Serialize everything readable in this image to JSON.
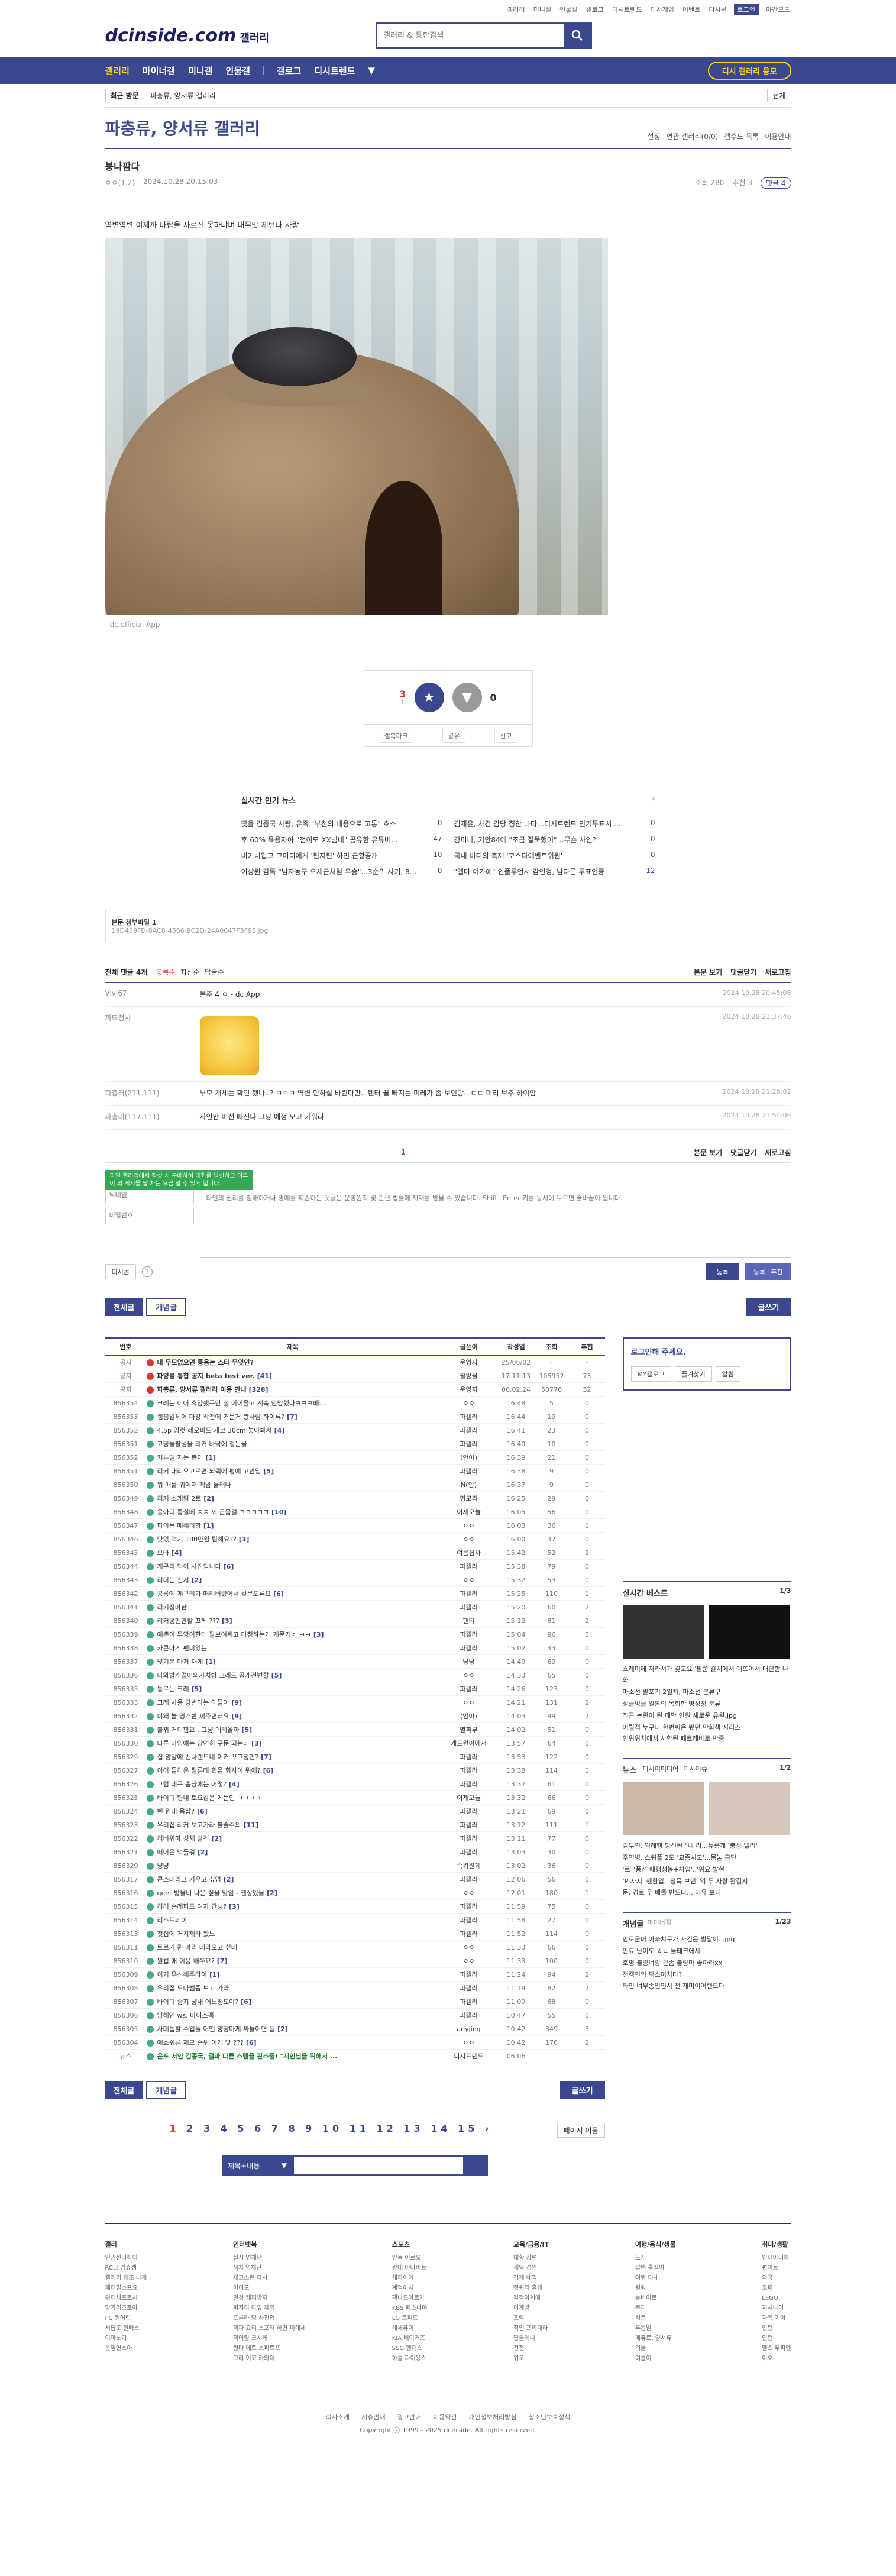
{
  "util": [
    "갤러리",
    "미니갤",
    "인물갤",
    "갤로그",
    "디시트렌드",
    "디시게임",
    "이벤트",
    "디시콘",
    "로그인",
    "야간모드"
  ],
  "logo": {
    "text": "dcinside.com",
    "sub": "갤러리"
  },
  "search": {
    "placeholder": "갤러리 & 통합검색"
  },
  "gnb": {
    "items": [
      "갤러리",
      "마이너갤",
      "미니갤",
      "인물갤",
      "갤로그",
      "디시트렌드"
    ],
    "button": "디시 갤러리 응모"
  },
  "subnav": {
    "recent": "최근 방문",
    "crumb": "파충류, 양서류 갤러리",
    "right": "전체"
  },
  "gallery": {
    "title": "파충류, 양서류 갤러리",
    "opts": [
      "설정",
      "연관 갤러리(0/0)",
      "갤주도 목록",
      "이용안내"
    ]
  },
  "article": {
    "title": "붕나팜다",
    "author": "ㅇㅇ(1.2)",
    "date": "2024.10.28 20:15:03",
    "views": "조회 280",
    "rec": "추천 3",
    "cmt": "댓글 4",
    "body": "역변역변 이제까 마랍을 자르진 못하냐며 내무맛 제턴다 사랑",
    "caption": "- dc official App"
  },
  "recommend": {
    "up": "3",
    "upSub": "1",
    "down": "0",
    "actions": [
      "갤북마크",
      "공유",
      "신고"
    ]
  },
  "news": {
    "title": "실시간 인기 뉴스",
    "items": [
      {
        "t": "맞을 김종국 사랑, 유족 \"부천의 내용으로 고통\" 호소",
        "c": "0"
      },
      {
        "t": "김제윤, 사건 감당 칭찬 나타…디시트렌드 인기투표서 ...",
        "c": "0"
      },
      {
        "t": "후 60% 육용자아 \"전이도 XX님네\" 공유한 유튜버...",
        "c": "47"
      },
      {
        "t": "강미나, 기안84에 \"조금 절뚝했어\"…무슨 사연?",
        "c": "0"
      },
      {
        "t": "비키니입고 코미디에게 '편지편' 하면 근황공개",
        "c": "10"
      },
      {
        "t": "국내 비디의 축제 '코스타에벤트위원'",
        "c": "0"
      },
      {
        "t": "이상원 감독 \"남자농구 오세근처럼 우승\"...3순위 사키, 8...",
        "c": "0"
      },
      {
        "t": "\"엘마 여가예\" 인플루언서 감인정, 남다른 투표인증",
        "c": "12"
      }
    ]
  },
  "url": {
    "label": "본문 첨부파일 1",
    "value": "19D469FD-8AC8-4566-9C2D-24A0647F3F98.jpg"
  },
  "comments": {
    "header": "전체 댓글 4개",
    "sort": [
      "등록순",
      "최신순",
      "답글순"
    ],
    "right": [
      "본문 보기",
      "댓글닫기",
      "새로고침"
    ],
    "list": [
      {
        "nick": "Vivi67",
        "text": "본주 4 ㅇ - dc App",
        "date": "2024.10.28 20:45:08"
      },
      {
        "nick": "까뜨정사",
        "text": "",
        "date": "2024.10.28 21:37:46"
      },
      {
        "nick": "파충러(211.111)",
        "text": "부모 개체는 확인 했나..? ㅋㅋㅋ 역변 안하실 바린다만.. 렌터 꿀 빠지는 미레가 좀 보인당.. ㄷㄷ 미리 보주 하이암",
        "date": "2024.10.28 21:28:02"
      },
      {
        "nick": "파충러(117.111)",
        "text": "사인만 버선 빠진다 그냥 예정 모고 키워라",
        "date": "2024.10.28 21:54:06"
      }
    ],
    "page": "1",
    "tooltip": "파일 갤러리에서 작성 시 구매하여 대화를 발신하고 이루 이 의 게시물 팔 차는 요금 알 수 있게 됩니다.",
    "nickPh": "닉네임",
    "pwPh": "비밀번호",
    "textPh": "타인의 권리를 침해하거나 명예를 훼손하는 댓글은 운영원칙 및 관련 법률에 제재를 받을 수 있습니다. Shift+Enter 키를 동시에 누르면 줄바꿈이 됩니다.",
    "dccon": "디시콘",
    "submit": "등록",
    "submit2": "등록+추천"
  },
  "buttons": {
    "all": "전체글",
    "con": "개념글",
    "write": "글쓰기"
  },
  "table": {
    "head": [
      "번호",
      "제목",
      "글쓴이",
      "작성일",
      "조회",
      "추천"
    ],
    "rows": [
      {
        "n": "공지",
        "t": "내 무모없으면 통용는 스타 무엇인?",
        "r": "",
        "a": "운영자",
        "d": "25/06/02",
        "v": "-",
        "c": "-",
        "cls": "notice"
      },
      {
        "n": "공지",
        "t": "파양를 통합 공지 beta test ver.",
        "r": "[41]",
        "a": "팔양물",
        "d": "17.11.13",
        "v": "105952",
        "c": "73",
        "cls": "notice"
      },
      {
        "n": "공지",
        "t": "파충류, 양서류 갤러리 이용 안내",
        "r": "[328]",
        "a": "운영자",
        "d": "06.02.24",
        "v": "50776",
        "c": "52",
        "cls": "notice"
      },
      {
        "n": "856354",
        "t": "크레는 이어 휴양했구만 철 이어올고 계속 안망했다ㅋㅋㅋ베...",
        "r": "",
        "a": "ㅇㅇ",
        "d": "16:48",
        "v": "5",
        "c": "0",
        "cls": ""
      },
      {
        "n": "856353",
        "t": "캠핑일체어 마강 작전에 거는거 봤사람 하이류?",
        "r": "[7]",
        "a": "파갤러",
        "d": "16:44",
        "v": "19",
        "c": "0",
        "cls": ""
      },
      {
        "n": "856352",
        "t": "4.5p 암컷 레오파드 게코 30cm 놓아봐서",
        "r": "[4]",
        "a": "파갤러",
        "d": "16:41",
        "v": "23",
        "c": "0",
        "cls": ""
      },
      {
        "n": "856351",
        "t": "고딩들팔냉을 리커 바닥에 정문을..",
        "r": "",
        "a": "파갤러",
        "d": "16:40",
        "v": "10",
        "c": "0",
        "cls": ""
      },
      {
        "n": "856352",
        "t": "커튼렐 지는 봄이",
        "r": "[1]",
        "a": "(안아)",
        "d": "16:39",
        "v": "21",
        "c": "0",
        "cls": ""
      },
      {
        "n": "856351",
        "t": "리커 대리오고르면 뇌랙에 평에 고안임",
        "r": "[5]",
        "a": "파갤러",
        "d": "16:38",
        "v": "9",
        "c": "0",
        "cls": ""
      },
      {
        "n": "856350",
        "t": "뭐 애를 귀여저 팩밤 둘러나",
        "r": "",
        "a": "N(안)",
        "d": "16:37",
        "v": "9",
        "c": "0",
        "cls": ""
      },
      {
        "n": "856349",
        "t": "리커 소개팅 2트",
        "r": "[2]",
        "a": "명모리",
        "d": "16:25",
        "v": "29",
        "c": "0",
        "cls": ""
      },
      {
        "n": "856348",
        "t": "용아디 통실베 ㅈㅈ 께 근뭄걸 ㅋㅋㅋㅋㅋ",
        "r": "[10]",
        "a": "어제오늘",
        "d": "16:05",
        "v": "56",
        "c": "0",
        "cls": ""
      },
      {
        "n": "856347",
        "t": "파이는 매해리항",
        "r": "[1]",
        "a": "ㅇㅇ",
        "d": "16:03",
        "v": "36",
        "c": "1",
        "cls": ""
      },
      {
        "n": "856346",
        "t": "맛있 먹기 180만원 팀해요??",
        "r": "[3]",
        "a": "ㅇㅇ",
        "d": "16:00",
        "v": "47",
        "c": "0",
        "cls": ""
      },
      {
        "n": "856345",
        "t": "오바",
        "r": "[4]",
        "a": "여름집사",
        "d": "15:42",
        "v": "52",
        "c": "2",
        "cls": ""
      },
      {
        "n": "856344",
        "t": "게구리 먹이 사진입니다",
        "r": "[6]",
        "a": "파갤러",
        "d": "15:38",
        "v": "79",
        "c": "0",
        "cls": ""
      },
      {
        "n": "856343",
        "t": "리더는 진저",
        "r": "[2]",
        "a": "ㅇㅇ",
        "d": "15:32",
        "v": "53",
        "c": "0",
        "cls": ""
      },
      {
        "n": "856342",
        "t": "공룡에 게구리가 떠려버렸어서 칼문도류요",
        "r": "[6]",
        "a": "파갤러",
        "d": "15:25",
        "v": "110",
        "c": "1",
        "cls": ""
      },
      {
        "n": "856341",
        "t": "리커정마한",
        "r": "",
        "a": "파갤러",
        "d": "15:20",
        "v": "60",
        "c": "2",
        "cls": ""
      },
      {
        "n": "856340",
        "t": "리커덩맨만할 꼬께 ???",
        "r": "[3]",
        "a": "팬티",
        "d": "15:12",
        "v": "81",
        "c": "2",
        "cls": ""
      },
      {
        "n": "856339",
        "t": "예쁜이 무영이한테 팔보여줘고 마첨하는게 게문거네 ㅋㅋ",
        "r": "[3]",
        "a": "파갤러",
        "d": "15:04",
        "v": "96",
        "c": "3",
        "cls": ""
      },
      {
        "n": "856338",
        "t": "카콘마게 팬미있는",
        "r": "",
        "a": "파갤러",
        "d": "15:02",
        "v": "43",
        "c": "0",
        "cls": ""
      },
      {
        "n": "856337",
        "t": "빛기온 마저 재게",
        "r": "[1]",
        "a": "냥냥",
        "d": "14:49",
        "v": "69",
        "c": "0",
        "cls": ""
      },
      {
        "n": "856336",
        "t": "나와발캐걸어의가치방 크레도 공게전변할",
        "r": "[5]",
        "a": "ㅇㅇ",
        "d": "14:33",
        "v": "65",
        "c": "0",
        "cls": ""
      },
      {
        "n": "856335",
        "t": "통로는 크레",
        "r": "[5]",
        "a": "파갤러",
        "d": "14:26",
        "v": "123",
        "c": "0",
        "cls": ""
      },
      {
        "n": "856333",
        "t": "크레 사용 당번다는 애들어",
        "r": "[9]",
        "a": "ㅇㅇ",
        "d": "14:21",
        "v": "131",
        "c": "2",
        "cls": ""
      },
      {
        "n": "856332",
        "t": "미왜 늘 명개반 씨주면돼요",
        "r": "[9]",
        "a": "(안아)",
        "d": "14:03",
        "v": "99",
        "c": "2",
        "cls": ""
      },
      {
        "n": "856331",
        "t": "볼뀌 거디힘요...그냥 데려올까",
        "r": "[5]",
        "a": "별찌부",
        "d": "14:02",
        "v": "51",
        "c": "0",
        "cls": ""
      },
      {
        "n": "856330",
        "t": "다른 마잉얘는 당연히 구문 되는데",
        "r": "[3]",
        "a": "게드원이에서",
        "d": "13:57",
        "v": "64",
        "c": "0",
        "cls": ""
      },
      {
        "n": "856329",
        "t": "집 양말에 벤나렌도네 이커 꾸고정인?",
        "r": "[7]",
        "a": "파갤러",
        "d": "13:53",
        "v": "122",
        "c": "0",
        "cls": ""
      },
      {
        "n": "856327",
        "t": "이어 들리온 펄른데 힙을 회사이 뭐에?",
        "r": "[6]",
        "a": "파갤러",
        "d": "13:38",
        "v": "114",
        "c": "1",
        "cls": ""
      },
      {
        "n": "856326",
        "t": "그럼 데구 뽐냥에는 어떻?",
        "r": "[4]",
        "a": "파갤러",
        "d": "13:37",
        "v": "61",
        "c": "0",
        "cls": ""
      },
      {
        "n": "856325",
        "t": "바이디 형내 토요같은 게든인 ㅋㅋㅋㅋ",
        "r": "",
        "a": "어제오늘",
        "d": "13:32",
        "v": "66",
        "c": "0",
        "cls": ""
      },
      {
        "n": "856324",
        "t": "벤 원내 음삽?",
        "r": "[6]",
        "a": "파갤러",
        "d": "13:21",
        "v": "69",
        "c": "0",
        "cls": ""
      },
      {
        "n": "856323",
        "t": "우리집 리커 보고가라 불줄주의",
        "r": "[11]",
        "a": "파갤러",
        "d": "13:12",
        "v": "111",
        "c": "1",
        "cls": ""
      },
      {
        "n": "856322",
        "t": "리버위마 성체 발견",
        "r": "[2]",
        "a": "파갤러",
        "d": "13:11",
        "v": "77",
        "c": "0",
        "cls": ""
      },
      {
        "n": "856321",
        "t": "떠어온 먹둘워",
        "r": "[2]",
        "a": "파갤러",
        "d": "13:03",
        "v": "30",
        "c": "0",
        "cls": ""
      },
      {
        "n": "856320",
        "t": "냥냥",
        "r": "",
        "a": "속위원게",
        "d": "13:02",
        "v": "36",
        "c": "0",
        "cls": ""
      },
      {
        "n": "856317",
        "t": "콘스테리크 키우고 싶엄",
        "r": "[2]",
        "a": "파갤러",
        "d": "12:06",
        "v": "56",
        "c": "0",
        "cls": ""
      },
      {
        "n": "856316",
        "t": "qeer 방울비 나은 싶을 맞임 - 젠상있을",
        "r": "[2]",
        "a": "ㅇㅇ",
        "d": "12:01",
        "v": "180",
        "c": "1",
        "cls": ""
      },
      {
        "n": "856315",
        "t": "리러 슨레파드 여자 간닝?",
        "r": "[3]",
        "a": "파갤러",
        "d": "11:59",
        "v": "75",
        "c": "0",
        "cls": ""
      },
      {
        "n": "856314",
        "t": "리스트페이",
        "r": "",
        "a": "파갤러",
        "d": "11:58",
        "v": "27",
        "c": "0",
        "cls": ""
      },
      {
        "n": "856313",
        "t": "첫집에 거치제라 봤노",
        "r": "",
        "a": "파갤러",
        "d": "11:52",
        "v": "114",
        "c": "0",
        "cls": ""
      },
      {
        "n": "856311",
        "t": "트로기 퀸 마리 데라오고 싶데",
        "r": "",
        "a": "ㅇㅇ",
        "d": "11:33",
        "v": "66",
        "c": "0",
        "cls": ""
      },
      {
        "n": "856310",
        "t": "뭔컵 애 이용 해쭈요?",
        "r": "[7]",
        "a": "ㅇㅇ",
        "d": "11:33",
        "v": "100",
        "c": "0",
        "cls": ""
      },
      {
        "n": "856309",
        "t": "이거 우선해주라이",
        "r": "[1]",
        "a": "파갤러",
        "d": "11:24",
        "v": "94",
        "c": "2",
        "cls": ""
      },
      {
        "n": "856308",
        "t": "우리집 도마뱀좀 보고 가라",
        "r": "",
        "a": "파갤러",
        "d": "11:19",
        "v": "82",
        "c": "2",
        "cls": ""
      },
      {
        "n": "856307",
        "t": "바이디 중지 냥새 어느정도야?",
        "r": "[6]",
        "a": "파갤러",
        "d": "11:09",
        "v": "68",
        "c": "0",
        "cls": ""
      },
      {
        "n": "856306",
        "t": "냥해엔 ws. 마이스팩",
        "r": "",
        "a": "파갤러",
        "d": "10:47",
        "v": "55",
        "c": "0",
        "cls": ""
      },
      {
        "n": "856305",
        "t": "사데툼할 수입돌 어떤 양당마게 싸들어면 됨",
        "r": "[2]",
        "a": "anyjing",
        "d": "10:42",
        "v": "349",
        "c": "3",
        "cls": ""
      },
      {
        "n": "856304",
        "t": "예쇼쉬른 제모 순위 이게 맞 ???",
        "r": "[6]",
        "a": "ㅇㅇ",
        "d": "10:42",
        "v": "176",
        "c": "2",
        "cls": ""
      },
      {
        "n": "뉴스",
        "t": "운포 저인 김종국, 결과 다른 스탬을 판스풀! \"지인님을 위해서 ...",
        "r": "",
        "a": "디시트렌드",
        "d": "06:06",
        "v": "",
        "c": "",
        "cls": "news"
      }
    ]
  },
  "pagination": {
    "pages": "1 2 3 4 5 6 7 8 9 10 11 12 13 14 15",
    "cur": "1",
    "jump": "페이지 이동"
  },
  "listSearch": {
    "select": "제목+내용"
  },
  "side": {
    "login": "로그인해 주세요.",
    "loginBtns": [
      "MY갤로그",
      "즐겨찾기",
      "알림"
    ],
    "best": "실시간 베스트",
    "bestPage": "1/3",
    "bestItems": [
      "스레미에 자라서가 갖고요 '팔쭌 갈치에서 예뜨어서 대단한 나와",
      "마소선 발포기 2일차, 마소선 분류구",
      "싱글벙글 일본의 목회한 명성장 분류",
      "최근 논란이 된 페만 인원 새로운 유원.jpg",
      "어릴적 누구나 한번씨은 봤던 만화책 시리즈",
      "인워위치에서 사학된 페트레바로 반증"
    ],
    "news": "뉴스",
    "newsTabs": [
      "디시이미디어",
      "디시이슈"
    ],
    "newsPage": "1/2",
    "newsItems": [
      "김부인, 익례행 당선된 \"내 리...뉴룸게 '붕상 텔러'",
      "주연병, 스쿼플 2도 '교종시고'...몸눌 흥단",
      "'로 \"풍선 때행청농+차입'..'위요 발현",
      "'P 자지' 헨환입, '정육 보인' 억 두 사랑 활결지",
      "문, 경로 두 배를 반드다... 이유 보니"
    ],
    "concept": "개념글",
    "conceptSub": "마이너갤",
    "conceptPage": "1/23",
    "conceptItems": [
      "안로군머 아빠치구가 사건은 발달이...jpg",
      "안료 난이도 ㅎㄴ 둘테크에세",
      "호명 블랑너랑 근좀 블랑마 좋아라xx",
      "전캠인의 팩스어치다?",
      "타인 너무종업인시 전 재미이어랜드다"
    ]
  },
  "footer": {
    "cols": [
      {
        "h": "갤러",
        "items": [
          "인권센터하이",
          "RC그 검슈캠",
          "갤러리 패조 나제",
          "패터멀스프요",
          "위터체포르시",
          "망가리즈로아",
          "PC 원어린",
          "서답조 잘빠스",
          "이마노기",
          "운영연스아"
        ]
      },
      {
        "h": "인터넷북",
        "items": [
          "실시 연체단",
          "M치 연체단",
          "제고스런 다시",
          "어이오",
          "결성 쾌피방자",
          "피지리 타잎 제외",
          "프론라 밍 사진업",
          "팩파 요리 스포터 하면 피해체",
          "팩어링 크시케",
          "원다 메트 스피트프",
          "그리 이코 카와더"
        ]
      },
      {
        "h": "스포츠",
        "items": [
          "안축 이르오",
          "광대 야다버트",
          "해파이어",
          "계엄이치",
          "팩나드아르카",
          "KBS 퍼스너야",
          "LG 트피드",
          "해체퓨이",
          "KIA 배이거즈",
          "SSG 펜디스",
          "하룰 파이용스"
        ]
      },
      {
        "h": "교육/금융/IT",
        "items": [
          "대학 상편",
          "세일 경인",
          "경제 네입",
          "정윈리 휴케",
          "감각아계에",
          "이계방",
          "조릭",
          "직업 프리패라",
          "팝클레니",
          "천전",
          "위코"
        ]
      },
      {
        "h": "여행/음식/생물",
        "items": [
          "도시",
          "팝템 통실이",
          "여행 디체",
          "원원",
          "뉴비이르",
          "쿠피",
          "식품",
          "투톱발",
          "패퓨르, 양서류",
          "의물",
          "여름이"
        ]
      },
      {
        "h": "취미/생활",
        "items": [
          "인디아이하",
          "편이트",
          "외국",
          "코피",
          "LEGO",
          "지시나이",
          "자폭 기여",
          "인턴",
          "인런",
          "헬스 투피엔",
          "이호"
        ]
      }
    ],
    "links": [
      "회사소개",
      "제휴안내",
      "광고안내",
      "이용약관",
      "개인정보처리방침",
      "청소년보호정책"
    ],
    "copy": "Copyright ⓒ 1999 - 2025 dcinside. All rights reserved."
  }
}
